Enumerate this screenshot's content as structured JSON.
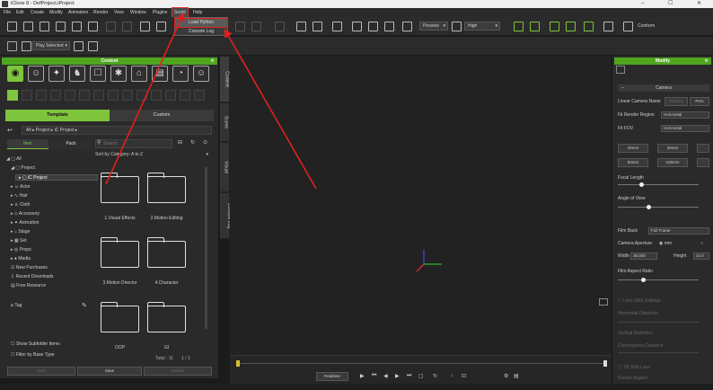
{
  "window": {
    "title": "iClone 8 - DefProject.iProject",
    "controls": [
      "–",
      "☐",
      "✕"
    ]
  },
  "menubar": [
    "File",
    "Edit",
    "Create",
    "Modify",
    "Animation",
    "Render",
    "View",
    "Window",
    "Plugins",
    "Script",
    "Help"
  ],
  "script_menu": {
    "active_menu": "Script",
    "items": [
      "Load Python",
      "Console Log"
    ]
  },
  "toolbar": {
    "preview_select": "Preview",
    "quality_select": "High",
    "conform_label": "Conform",
    "selection_select": "Play Selected"
  },
  "content_panel": {
    "title": "Content",
    "mode_tabs": [
      "Template",
      "Custom"
    ],
    "breadcrumb": "All ▸ Project ▸ iC Project ▸",
    "source_tabs": [
      "Item",
      "Pack"
    ],
    "search_placeholder": "Search",
    "sort_label": "Sort by Category: A to Z",
    "tree": [
      "All",
      "Project",
      "iC Project",
      "Actor",
      "Hair",
      "Cloth",
      "Accessory",
      "Animation",
      "Stage",
      "Set",
      "Props",
      "Media",
      "New Purchases",
      "Recent Downloads",
      "Free Resource",
      "Tag"
    ],
    "folders": [
      "1.Visual Effects",
      "2.Motion Editing",
      "3.Motion Director",
      "4.Character",
      "DOP",
      "GI"
    ],
    "total": "Total : 11",
    "pager": "1 / 1",
    "show_subfolder": "Show Subfolder Items",
    "filter_base": "Filter by Base Type",
    "buttons": [
      "Apply",
      "Save",
      "Details"
    ]
  },
  "side_tabs": [
    "Content",
    "Scene",
    "Visual",
    "Console Log"
  ],
  "timeline": {
    "realtime_label": "Realtime"
  },
  "modify_panel": {
    "title": "Modify",
    "section": "Camera",
    "linear_camera_label": "Linear Camera Name",
    "linear_buttons": [
      "Preview",
      "Pers"
    ],
    "fit_render_label": "Fit Render Region",
    "fit_render_value": "Horizontal",
    "fit_fov_label": "Fit FOV",
    "fit_fov_value": "Horizontal",
    "lens_buttons": [
      "20mm",
      "35mm",
      "50mm",
      "105mm"
    ],
    "focal_length_label": "Focal Length",
    "angle_of_view_label": "Angle of View",
    "film_back_label": "Film Back",
    "film_back_value": "Full Frame",
    "camera_aperture_label": "Camera Aperture",
    "aperture_unit_mm": "mm",
    "width_label": "Width",
    "width_value": "36.000",
    "height_label": "Height",
    "height_value": "24.0",
    "film_aspect_label": "Film Aspect Ratio",
    "disabled_rows": [
      "Lens Shift Settings",
      "Horizontal Distortion",
      "Vertical Distortion",
      "Convergence Distance",
      "Tilt Shift Lens",
      "Render Aspect"
    ]
  },
  "colors": {
    "accent_green": "#4ea51e",
    "highlight_red": "#e02020",
    "panel_bg": "#2a2a2a",
    "viewport_bg": "#222222"
  }
}
